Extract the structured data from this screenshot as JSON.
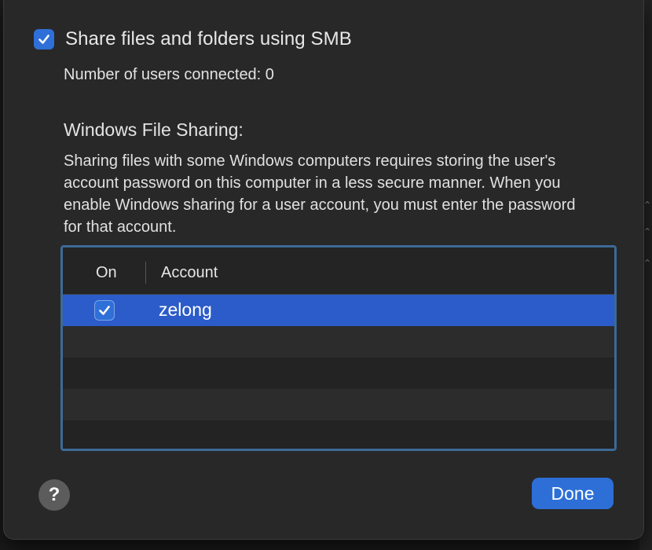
{
  "smb": {
    "checkbox_label": "Share files and folders using SMB",
    "checked": true,
    "users_connected": "Number of users connected: 0"
  },
  "windows_sharing": {
    "title": "Windows File Sharing:",
    "description": "Sharing files with some Windows computers requires storing the user's account password on this computer in a less secure manner. When you enable Windows sharing for a user account, you must enter the password for that account."
  },
  "table": {
    "columns": [
      "On",
      "Account"
    ],
    "rows": [
      {
        "on": true,
        "account": "zelong",
        "selected": true
      }
    ]
  },
  "buttons": {
    "help_label": "?",
    "done_label": "Done"
  },
  "colors": {
    "accent": "#2d6fd6",
    "selection": "#2c5cc9",
    "sheet_background": "#282828",
    "table_focus_ring": "#3d6a96"
  },
  "icons": {
    "checkbox_check": "checkmark-icon",
    "help": "question-mark-icon"
  }
}
